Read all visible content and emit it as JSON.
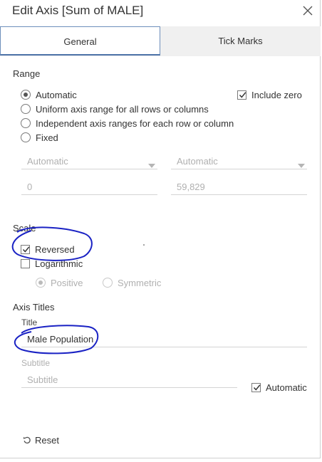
{
  "window": {
    "title": "Edit Axis [Sum of MALE]"
  },
  "tabs": [
    {
      "label": "General",
      "active": true
    },
    {
      "label": "Tick Marks",
      "active": false
    }
  ],
  "range": {
    "label": "Range",
    "options": [
      {
        "label": "Automatic",
        "selected": true
      },
      {
        "label": "Uniform axis range for all rows or columns",
        "selected": false
      },
      {
        "label": "Independent axis ranges for each row or column",
        "selected": false
      },
      {
        "label": "Fixed",
        "selected": false
      }
    ],
    "include_zero": {
      "label": "Include zero",
      "checked": true
    },
    "start_select": "Automatic",
    "end_select": "Automatic",
    "start_value": "0",
    "end_value": "59,829"
  },
  "scale": {
    "label": "Scale",
    "reversed": {
      "label": "Reversed",
      "checked": true
    },
    "logarithmic": {
      "label": "Logarithmic",
      "checked": false
    },
    "positive": {
      "label": "Positive",
      "selected": true
    },
    "symmetric": {
      "label": "Symmetric",
      "selected": false
    }
  },
  "axis_titles": {
    "label": "Axis Titles",
    "title_label": "Title",
    "title_value": "Male Population",
    "subtitle_label": "Subtitle",
    "subtitle_placeholder": "Subtitle",
    "automatic": {
      "label": "Automatic",
      "checked": true
    }
  },
  "footer": {
    "reset_label": "Reset"
  },
  "colors": {
    "accent": "#4d73a8",
    "annotation": "#1a22c4"
  }
}
